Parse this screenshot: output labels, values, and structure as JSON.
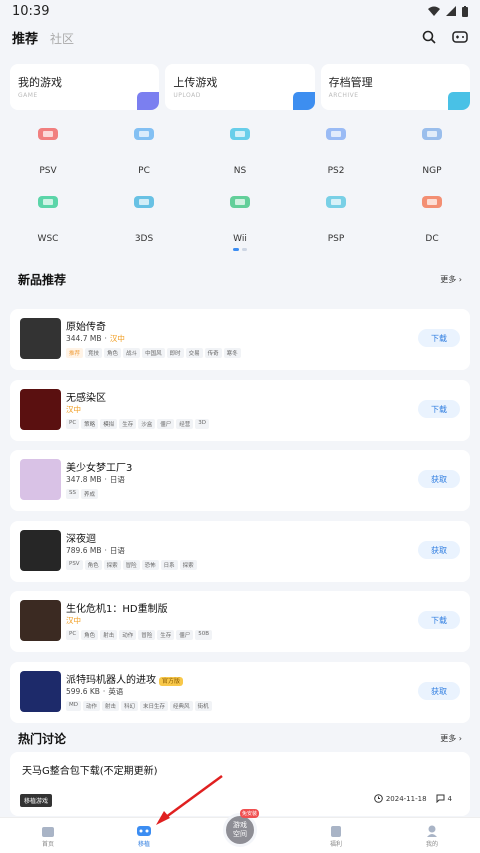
{
  "status": {
    "time": "10:39"
  },
  "topnav": {
    "tab_recommend": "推荐",
    "tab_community": "社区"
  },
  "cards": [
    {
      "title": "我的游戏",
      "sub": "GAME",
      "color": "#7b7ff0"
    },
    {
      "title": "上传游戏",
      "sub": "UPLOAD",
      "color": "#3d8ef0"
    },
    {
      "title": "存档管理",
      "sub": "ARCHIVE",
      "color": "#49c1e6"
    }
  ],
  "platforms": [
    {
      "label": "PSV",
      "color": "#f06a6a",
      "icon": "handheld-icon"
    },
    {
      "label": "PC",
      "color": "#6fb6f2",
      "icon": "monitor-icon"
    },
    {
      "label": "NS",
      "color": "#4fc7e8",
      "icon": "switch-icon"
    },
    {
      "label": "PS2",
      "color": "#8ab0f5",
      "icon": "console-icon"
    },
    {
      "label": "NGP",
      "color": "#8ab4ea",
      "icon": "handheld-icon"
    },
    {
      "label": "WSC",
      "color": "#3fcf9b",
      "icon": "handheld-icon"
    },
    {
      "label": "3DS",
      "color": "#4fb7e0",
      "icon": "3ds-icon"
    },
    {
      "label": "Wii",
      "color": "#48c88a",
      "icon": "wii-remote-icon"
    },
    {
      "label": "PSP",
      "color": "#63c9e3",
      "icon": "psp-icon"
    },
    {
      "label": "DC",
      "color": "#f27c5c",
      "icon": "swirl-icon"
    }
  ],
  "new_section": {
    "title": "新品推荐",
    "more": "更多"
  },
  "games": [
    {
      "name": "原始传奇",
      "meta": [
        "344.7 MB",
        "·",
        "汉中"
      ],
      "status_idx": 2,
      "tags": [
        "推荐",
        "竞技",
        "角色",
        "战斗",
        "中国风",
        "即时",
        "交易",
        "传奇",
        "寒冬"
      ],
      "hl": 0,
      "btn": "下载",
      "cover": "#333",
      "badge": ""
    },
    {
      "name": "无感染区",
      "meta": [
        "汉中"
      ],
      "status_idx": 0,
      "tags": [
        "PC",
        "策略",
        "模拟",
        "生存",
        "沙盒",
        "僵尸",
        "经营",
        "3D"
      ],
      "hl": -1,
      "btn": "下载",
      "cover": "#5a1010",
      "badge": ""
    },
    {
      "name": "美少女梦工厂3",
      "meta": [
        "347.8 MB",
        "·",
        "日语"
      ],
      "status_idx": -1,
      "tags": [
        "SS",
        "养成"
      ],
      "hl": -1,
      "btn": "获取",
      "cover": "#d9c2e6",
      "badge": ""
    },
    {
      "name": "深夜迴",
      "meta": [
        "789.6 MB",
        "·",
        "日语"
      ],
      "status_idx": -1,
      "tags": [
        "PSV",
        "角色",
        "探索",
        "冒险",
        "恐怖",
        "日系",
        "探索"
      ],
      "hl": -1,
      "btn": "获取",
      "cover": "#262626",
      "badge": ""
    },
    {
      "name": "生化危机1：HD重制版",
      "meta": [
        "汉中"
      ],
      "status_idx": 0,
      "tags": [
        "PC",
        "角色",
        "射击",
        "动作",
        "冒险",
        "生存",
        "僵尸",
        "50B"
      ],
      "hl": -1,
      "btn": "下载",
      "cover": "#3b2a22",
      "badge": ""
    },
    {
      "name": "派特玛机器人的进攻",
      "meta": [
        "599.6 KB",
        "·",
        "英语"
      ],
      "status_idx": -1,
      "tags": [
        "MD",
        "动作",
        "射击",
        "科幻",
        "末日生存",
        "经典风",
        "街机"
      ],
      "hl": -1,
      "btn": "获取",
      "cover": "#1d2a6a",
      "badge": "官方版"
    }
  ],
  "hot_section": {
    "title": "热门讨论",
    "more": "更多"
  },
  "discussion": {
    "title": "天马G整合包下载(不定期更新)",
    "tag": "移植游戏",
    "date": "2024-11-18",
    "comments": "4"
  },
  "bottomnav": {
    "items": [
      "首页",
      "移植",
      "",
      "福利",
      "我的"
    ],
    "center_label": "游戏空间",
    "center_badge": "免安装"
  }
}
